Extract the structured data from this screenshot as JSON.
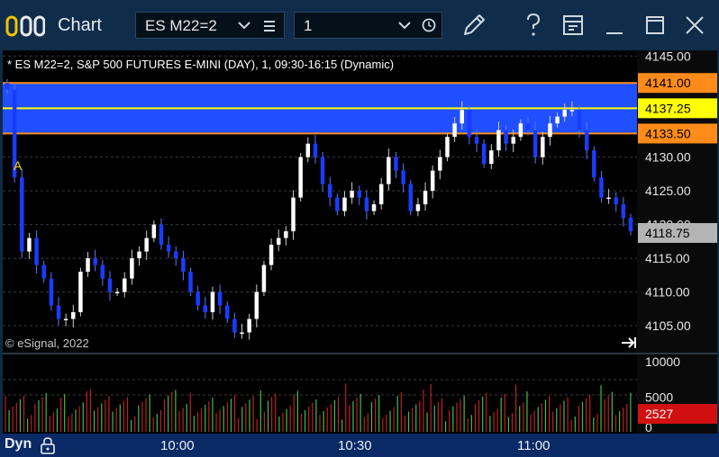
{
  "window": {
    "title": "Chart",
    "symbol": "ES M22=2",
    "interval": "1"
  },
  "chart": {
    "header": "* ES M22=2, S&P 500 FUTURES E-MINI (DAY), 1, 09:30-16:15 (Dynamic)",
    "copyright": "© eSignal, 2022",
    "marker_label": "A",
    "y_ticks": [
      "4145.00",
      "4130.00",
      "4125.00",
      "4120.00",
      "4115.00",
      "4110.00",
      "4105.00"
    ],
    "price_tags": [
      {
        "label": "4141.00",
        "bg": "#ff8c1a",
        "fg": "#000000"
      },
      {
        "label": "4137.25",
        "bg": "#ffff00",
        "fg": "#000000"
      },
      {
        "label": "4133.50",
        "bg": "#ff8c1a",
        "fg": "#000000"
      },
      {
        "label": "4118.75",
        "bg": "#b4b4b4",
        "fg": "#000000"
      }
    ],
    "volume_ticks": [
      "10000",
      "5000",
      "0"
    ],
    "volume_tag": {
      "label": "2527",
      "bg": "#d01010",
      "fg": "#ffffff"
    },
    "time_ticks": [
      "10:00",
      "10:30",
      "11:00"
    ],
    "status_label": "Dyn",
    "colors": {
      "background": "#000000",
      "band": "#1f4fff",
      "band_border": "#ff8c1a",
      "mid_line": "#ffff00",
      "up_candle": "#ffffff",
      "down_candle": "#1a3cff",
      "vol_up": "#40c040",
      "vol_down": "#c02020",
      "axis_bg": "#111111"
    }
  },
  "chart_data": {
    "type": "candlestick",
    "title": "* ES M22=2, S&P 500 FUTURES E-MINI (DAY), 1, 09:30-16:15 (Dynamic)",
    "ylim": [
      4102,
      4146
    ],
    "band": {
      "top": 4141.0,
      "mid": 4137.25,
      "bottom": 4133.5
    },
    "last": 4118.75,
    "closes": [
      4140,
      4127,
      4116,
      4118,
      4114,
      4112,
      4108,
      4106,
      4106,
      4107,
      4113,
      4115,
      4114,
      4112,
      4110,
      4110,
      4112,
      4115,
      4116,
      4118,
      4120,
      4117,
      4116,
      4115,
      4113,
      4110,
      4108,
      4107,
      4110,
      4108,
      4106,
      4104,
      4104,
      4106,
      4110,
      4114,
      4117,
      4118,
      4119,
      4124,
      4130,
      4132,
      4130,
      4126,
      4124,
      4122,
      4124,
      4125,
      4124,
      4122,
      4123,
      4126,
      4130,
      4128,
      4126,
      4122,
      4123,
      4125,
      4128,
      4130,
      4133,
      4135,
      4137,
      4133,
      4132,
      4129,
      4131,
      4134,
      4132,
      4133,
      4135,
      4134,
      4130,
      4133,
      4135,
      4136,
      4137,
      4137,
      4134,
      4131,
      4127,
      4124,
      4124,
      4123,
      4121,
      4119
    ],
    "volume_ylim": [
      0,
      10000
    ],
    "last_volume": 2527
  }
}
